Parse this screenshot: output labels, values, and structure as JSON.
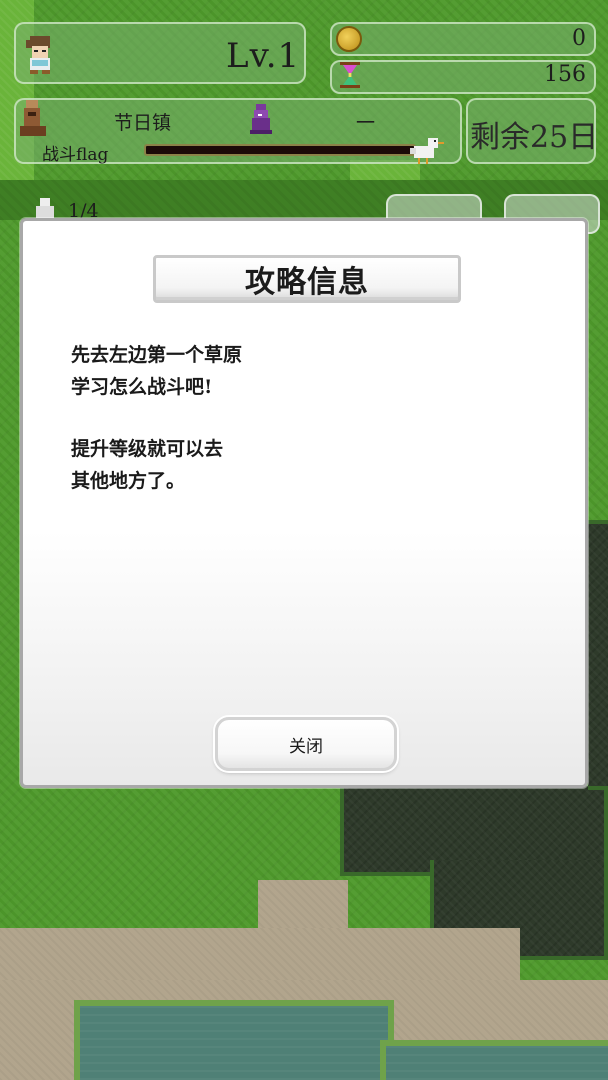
{
  "hud": {
    "level": "Lv.1",
    "gold": "0",
    "time": "156",
    "town": "节日镇",
    "dash": "一",
    "days_left": "剩余25日",
    "battle_flag_label": "战斗flag",
    "battle_flag_progress": 0.0,
    "party_count": "1/4"
  },
  "icons": {
    "hero": "hero-avatar",
    "coin": "coin-icon",
    "hourglass": "hourglass-icon",
    "totem": "totem-icon",
    "wizard": "wizard-icon",
    "chick": "chick-icon",
    "party": "party-icon"
  },
  "modal": {
    "title": "攻略信息",
    "lines": [
      "先去左边第一个草原",
      "学习怎么战斗吧!",
      "",
      "提升等级就可以去",
      "其他地方了。"
    ],
    "close_label": "关闭"
  },
  "colors": {
    "grass": "#4f9a2c",
    "forest": "#2e3a2a",
    "sand": "#b2a58d",
    "water": "#4f8076"
  }
}
